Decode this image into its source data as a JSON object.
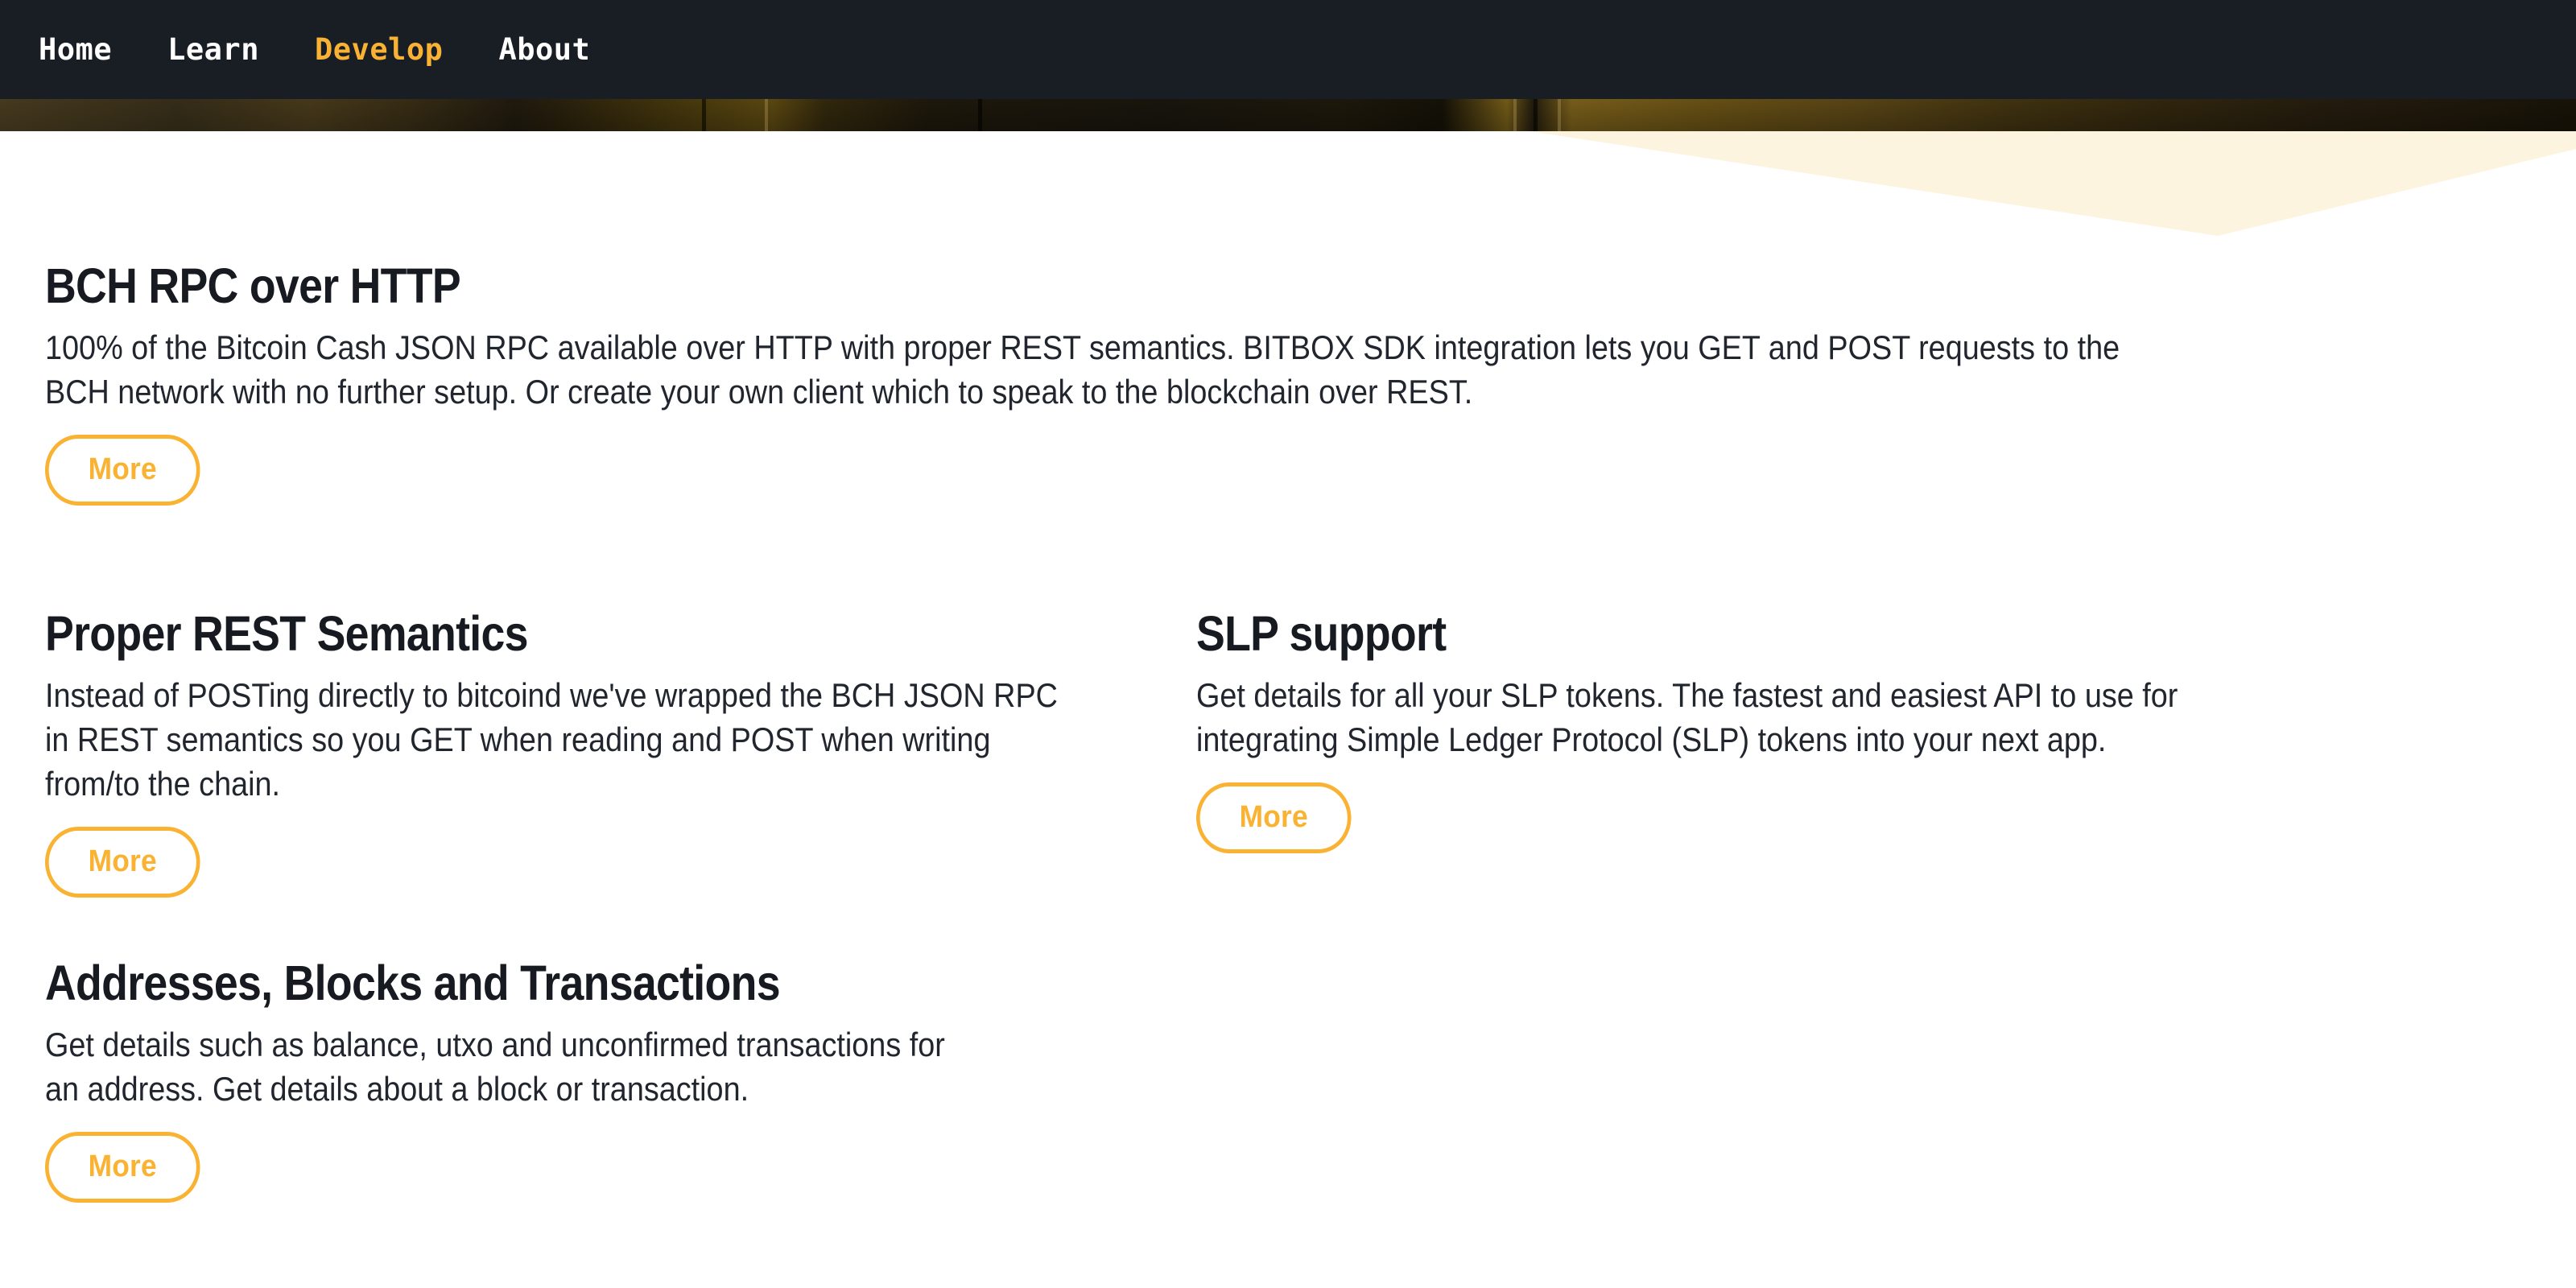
{
  "nav": {
    "items": [
      {
        "label": "Home",
        "active": false
      },
      {
        "label": "Learn",
        "active": false
      },
      {
        "label": "Develop",
        "active": true
      },
      {
        "label": "About",
        "active": false
      }
    ],
    "background_color": "#191e25",
    "active_color": "#f9b233",
    "text_color": "#ffffff"
  },
  "hero": {
    "description": "dark golden bokeh photograph strip",
    "wedge_color": "#fdf4e0"
  },
  "theme": {
    "accent": "#f9b231",
    "heading_color": "#171b21",
    "body_color": "#21262e",
    "page_background": "#ffffff"
  },
  "sections": [
    {
      "heading": "BCH RPC over HTTP",
      "body": "100% of the Bitcoin Cash JSON RPC available over HTTP with proper REST semantics. BITBOX SDK integration lets you GET and POST requests to the BCH network with no further setup. Or create your own client which to speak to the blockchain over REST.",
      "button": "More"
    },
    {
      "heading": "Proper REST Semantics",
      "body": "Instead of POSTing directly to bitcoind we've wrapped the BCH JSON RPC in REST semantics so you GET when reading and POST when writing from/to the chain.",
      "button": "More"
    },
    {
      "heading": "SLP support",
      "body": "Get details for all your SLP tokens. The fastest and easiest API to use for integrating Simple Ledger Protocol (SLP) tokens into your next app.",
      "button": "More"
    },
    {
      "heading": "Addresses, Blocks and Transactions",
      "body": "Get details such as balance, utxo and unconfirmed transactions for an address. Get details about a block or transaction.",
      "button": "More"
    }
  ]
}
